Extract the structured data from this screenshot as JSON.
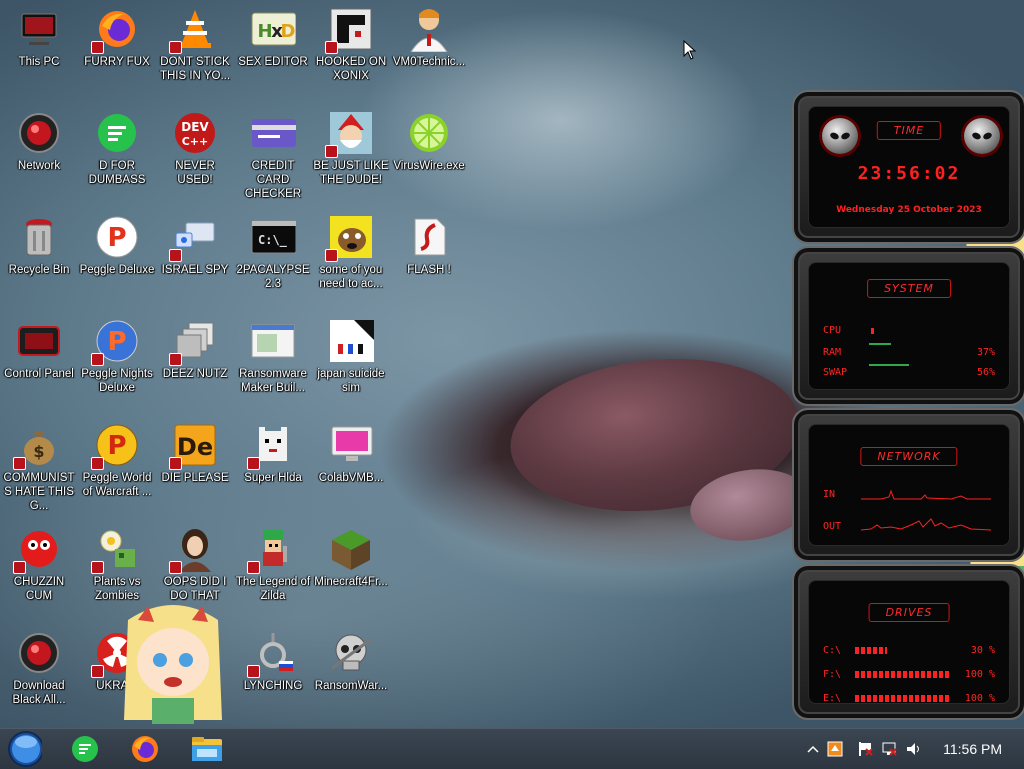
{
  "desktop": {
    "icons": [
      {
        "label": "This PC",
        "icon": "monitor-icon"
      },
      {
        "label": "FURRY FUX",
        "icon": "firefox-icon"
      },
      {
        "label": "DONT STICK THIS IN YO...",
        "icon": "vlc-cone-icon"
      },
      {
        "label": "SEX EDITOR",
        "icon": "hex-editor-icon"
      },
      {
        "label": "HOOKED ON XONIX",
        "icon": "xonix-icon"
      },
      {
        "label": "VM0Technic...",
        "icon": "doctor-icon"
      },
      {
        "label": "Network",
        "icon": "red-orb-icon"
      },
      {
        "label": "D FOR DUMBASS",
        "icon": "green-chat-icon"
      },
      {
        "label": "NEVER USED!",
        "icon": "devcpp-icon"
      },
      {
        "label": "CREDIT CARD CHECKER",
        "icon": "credit-card-icon"
      },
      {
        "label": "BE JUST LIKE THE DUDE!",
        "icon": "santa-icon"
      },
      {
        "label": "VirusWire.exe",
        "icon": "lime-icon"
      },
      {
        "label": "Recycle Bin",
        "icon": "recycle-bin-icon"
      },
      {
        "label": "Peggle Deluxe",
        "icon": "peggle-icon"
      },
      {
        "label": "ISRAEL SPY",
        "icon": "network-spy-icon"
      },
      {
        "label": "2PACALYPSE 2.3",
        "icon": "terminal-icon"
      },
      {
        "label": "some of you need to ac...",
        "icon": "scooby-icon"
      },
      {
        "label": "FLASH !",
        "icon": "flash-icon"
      },
      {
        "label": "Control Panel",
        "icon": "control-panel-icon"
      },
      {
        "label": "Peggle Nights Deluxe",
        "icon": "peggle-nights-icon"
      },
      {
        "label": "DEEZ NUTZ",
        "icon": "windows-stack-icon"
      },
      {
        "label": "Ransomware Maker Buil...",
        "icon": "window-app-icon"
      },
      {
        "label": "japan suicide sim",
        "icon": "japan-sim-icon"
      },
      {
        "label": "COMMUNISTS HATE THIS G...",
        "icon": "money-bag-icon"
      },
      {
        "label": "Peggle World of Warcraft ...",
        "icon": "peggle-wow-icon"
      },
      {
        "label": "DIE PLEASE",
        "icon": "de-icon"
      },
      {
        "label": "Super Hlda",
        "icon": "pixel-cat-icon"
      },
      {
        "label": "ColabVMB...",
        "icon": "monitor-pink-icon"
      },
      {
        "label": "CHUZZIN CUM",
        "icon": "chuzzle-icon"
      },
      {
        "label": "Plants vs Zombies",
        "icon": "pvz-icon"
      },
      {
        "label": "OOPS DID I DO THAT",
        "icon": "portrait-icon"
      },
      {
        "label": "The Legend of Zilda",
        "icon": "pixel-hero-icon"
      },
      {
        "label": "Minecraft4Fr...",
        "icon": "grass-block-icon"
      },
      {
        "label": "Download Black All...",
        "icon": "red-orb-icon"
      },
      {
        "label": "UKRA...",
        "icon": "radiation-icon"
      },
      {
        "label": "LYNCHING",
        "icon": "noose-icon"
      },
      {
        "label": "RansomWar...",
        "icon": "skull-icon"
      }
    ]
  },
  "gadget": {
    "time": {
      "title": "TIME",
      "clock": "23:56:02",
      "date": "Wednesday 25 October 2023"
    },
    "system": {
      "title": "SYSTEM",
      "rows": [
        {
          "label": "CPU",
          "value": ""
        },
        {
          "label": "RAM",
          "value": "37%"
        },
        {
          "label": "SWAP",
          "value": "56%"
        }
      ]
    },
    "network": {
      "title": "NETWORK",
      "rows": [
        {
          "label": "IN"
        },
        {
          "label": "OUT"
        }
      ]
    },
    "drives": {
      "title": "DRIVES",
      "rows": [
        {
          "label": "C:\\",
          "value": "30 %"
        },
        {
          "label": "F:\\",
          "value": "100 %"
        },
        {
          "label": "E:\\",
          "value": "100 %"
        }
      ]
    }
  },
  "taskbar": {
    "clock": "11:56 PM",
    "pinned": [
      {
        "icon": "start-orb-icon"
      },
      {
        "icon": "green-chat-icon"
      },
      {
        "icon": "firefox-icon"
      },
      {
        "icon": "file-explorer-icon"
      }
    ],
    "tray": [
      {
        "icon": "chevron-up-icon"
      },
      {
        "icon": "notification-icon"
      },
      {
        "icon": "flag-icon"
      },
      {
        "icon": "network-icon"
      },
      {
        "icon": "speaker-icon"
      }
    ]
  }
}
